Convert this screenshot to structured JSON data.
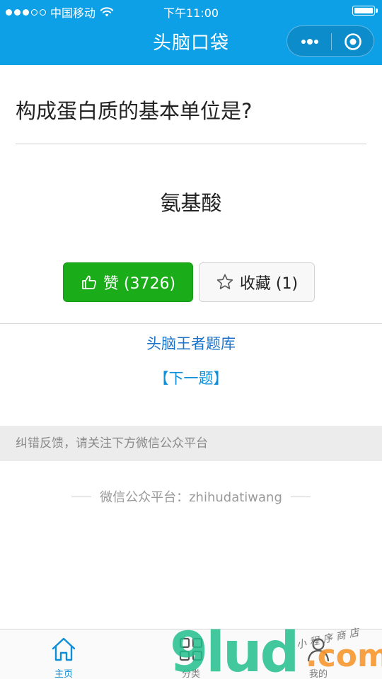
{
  "status_bar": {
    "carrier": "中国移动",
    "time": "下午11:00"
  },
  "nav": {
    "title": "头脑口袋",
    "capsule_more_icon": "more-dots-icon",
    "capsule_close_icon": "target-circle-icon"
  },
  "question": {
    "text": "构成蛋白质的基本单位是?",
    "answer": "氨基酸"
  },
  "actions": {
    "like_label": "赞 (3726)",
    "like_icon": "thumb-up-icon",
    "favorite_label": "收藏 (1)",
    "favorite_icon": "star-outline-icon"
  },
  "links": {
    "question_bank": "头脑王者题库",
    "next": "【下一题】"
  },
  "feedback": {
    "text": "纠错反馈，请关注下方微信公众平台"
  },
  "public_account": {
    "text": "微信公众平台：zhihudatiwang"
  },
  "tabbar": {
    "items": [
      {
        "label": "主页",
        "icon": "home-icon",
        "active": true
      },
      {
        "label": "分类",
        "icon": "grid-icon",
        "active": false
      },
      {
        "label": "我的",
        "icon": "person-icon",
        "active": false
      }
    ]
  },
  "watermark": {
    "brand": "9lud",
    "domain": ".com",
    "tagline": "小程序商店"
  },
  "colors": {
    "header": "#0ea0e6",
    "like_button": "#1aad19",
    "link_blue": "#1a73c8",
    "active_tab": "#0e8fd8"
  }
}
